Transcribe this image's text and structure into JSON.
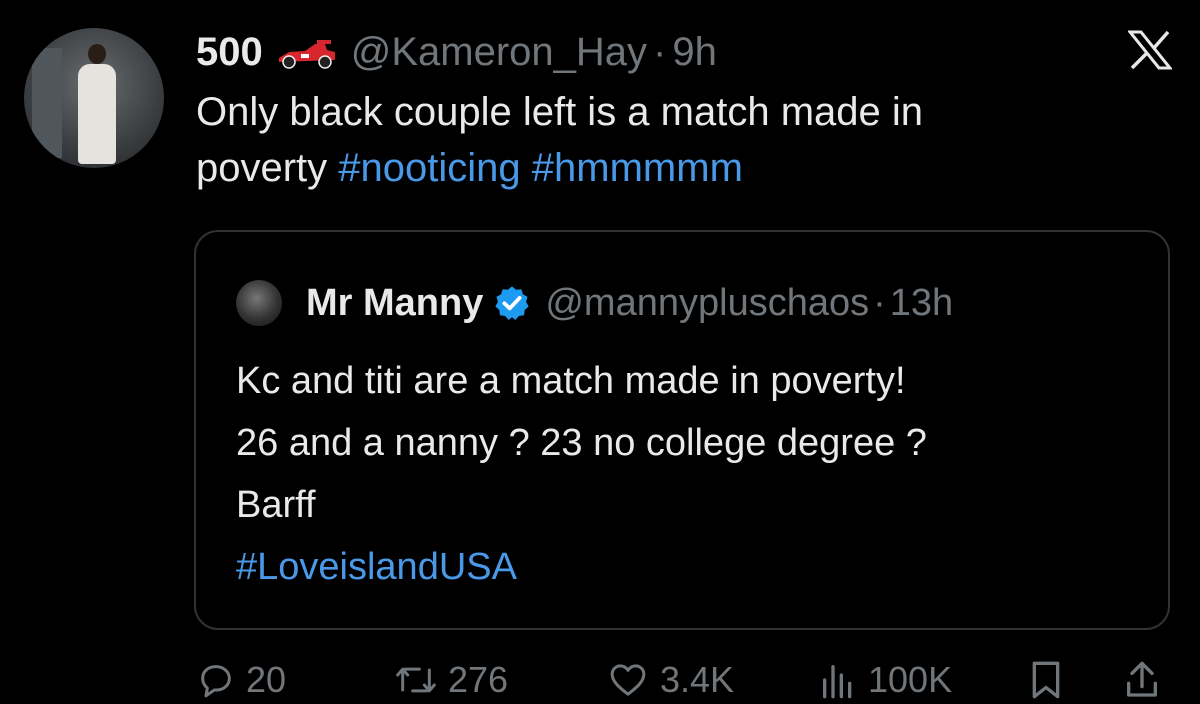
{
  "tweet": {
    "name": "500",
    "handle": "@Kameron_Hay",
    "separator": "·",
    "time": "9h",
    "text_plain_1": "Only black couple left is a match made in",
    "text_plain_2": "poverty ",
    "hashtag_1": "#nooticing",
    "hashtag_2": "#hmmmmm"
  },
  "quote": {
    "name": "Mr Manny",
    "handle": "@mannypluschaos",
    "separator": "·",
    "time": "13h",
    "lines": [
      "Kc and titi are a match made in poverty!",
      "26 and a nanny ? 23 no college degree ?",
      "Barff"
    ],
    "hashtag": "#LoveislandUSA"
  },
  "actions": {
    "replies": "20",
    "reposts": "276",
    "likes": "3.4K",
    "views": "100K"
  },
  "icons": {
    "badge": "race-car-icon",
    "close": "x-logo-icon",
    "verified": "verified-badge-icon",
    "reply": "reply-icon",
    "repost": "repost-icon",
    "like": "heart-icon",
    "views": "views-icon",
    "bookmark": "bookmark-icon",
    "share": "share-icon"
  },
  "colors": {
    "background": "#000000",
    "text": "#e7e9ea",
    "muted": "#71767b",
    "hashtag": "#4a99e9",
    "border": "#2f3336",
    "verified": "#1d9bf0"
  }
}
